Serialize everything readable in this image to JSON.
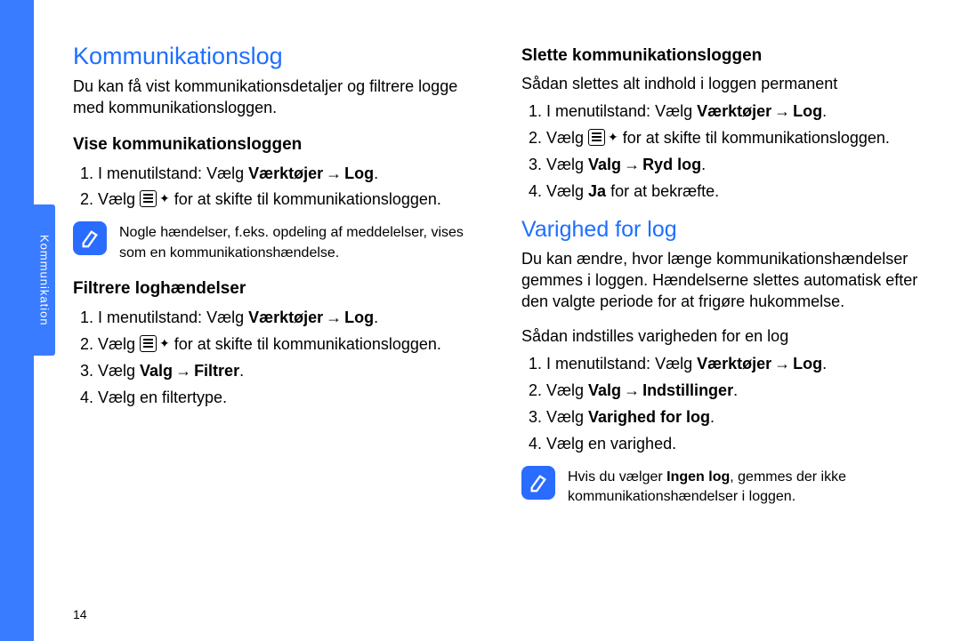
{
  "side_label": "Kommunikation",
  "page_number": "14",
  "col1": {
    "heading": "Kommunikationslog",
    "intro": "Du kan få vist kommunikationsdetaljer og filtrere logge med kommunikationsloggen.",
    "sec1_title": "Vise kommunikationsloggen",
    "sec1_step1_a": "I menutilstand: Vælg ",
    "sec1_step1_b": "Værktøjer",
    "sec1_step1_c": "Log",
    "sec1_step2_a": "Vælg ",
    "sec1_step2_b": " for at skifte til kommunikationsloggen.",
    "note1": "Nogle hændelser, f.eks. opdeling af meddelelser, vises som en kommunikationshændelse.",
    "sec2_title": "Filtrere loghændelser",
    "sec2_step1_a": "I menutilstand: Vælg ",
    "sec2_step1_b": "Værktøjer",
    "sec2_step1_c": "Log",
    "sec2_step2_a": "Vælg ",
    "sec2_step2_b": " for at skifte til kommunikationsloggen.",
    "sec2_step3_a": "Vælg ",
    "sec2_step3_b": "Valg",
    "sec2_step3_c": "Filtrer",
    "sec2_step4": "Vælg en filtertype."
  },
  "col2": {
    "sec1_title": "Slette kommunikationsloggen",
    "sec1_intro": "Sådan slettes alt indhold i loggen permanent",
    "sec1_step1_a": "I menutilstand: Vælg ",
    "sec1_step1_b": "Værktøjer",
    "sec1_step1_c": "Log",
    "sec1_step2_a": "Vælg ",
    "sec1_step2_b": " for at skifte til kommunikationsloggen.",
    "sec1_step3_a": "Vælg ",
    "sec1_step3_b": "Valg",
    "sec1_step3_c": "Ryd log",
    "sec1_step4_a": "Vælg ",
    "sec1_step4_b": "Ja",
    "sec1_step4_c": " for at bekræfte.",
    "heading2": "Varighed for log",
    "intro2": "Du kan ændre, hvor længe kommunikationshændelser gemmes i loggen. Hændelserne slettes automatisk efter den valgte periode for at frigøre hukommelse.",
    "intro3": "Sådan indstilles varigheden for en log",
    "sec2_step1_a": "I menutilstand: Vælg ",
    "sec2_step1_b": "Værktøjer",
    "sec2_step1_c": "Log",
    "sec2_step2_a": "Vælg ",
    "sec2_step2_b": "Valg",
    "sec2_step2_c": "Indstillinger",
    "sec2_step3_a": "Vælg ",
    "sec2_step3_b": "Varighed for log",
    "sec2_step4": "Vælg en varighed.",
    "note2_a": "Hvis du vælger ",
    "note2_b": "Ingen log",
    "note2_c": ", gemmes der ikke kommunikationshændelser i loggen."
  },
  "arrow": "→"
}
